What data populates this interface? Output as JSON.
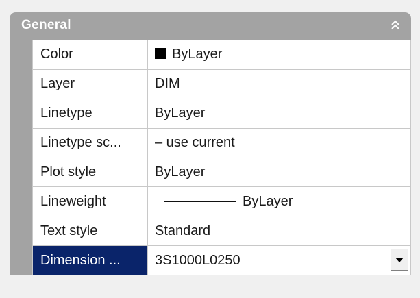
{
  "panel": {
    "section_title": "General",
    "collapse_icon": "chevron-double-up-icon"
  },
  "properties": [
    {
      "name": "Color",
      "value": "ByLayer",
      "swatch_color": "#000000"
    },
    {
      "name": "Layer",
      "value": "DIM"
    },
    {
      "name": "Linetype",
      "value": "ByLayer"
    },
    {
      "name": "Linetype sc...",
      "value": "– use current"
    },
    {
      "name": "Plot style",
      "value": "ByLayer"
    },
    {
      "name": "Lineweight",
      "value": "ByLayer"
    },
    {
      "name": "Text style",
      "value": "Standard"
    },
    {
      "name": "Dimension ...",
      "value": "3S1000L0250",
      "selected": true,
      "dropdown_icon": "dropdown-arrow-icon"
    }
  ],
  "colors": {
    "header_bg": "#a3a3a3",
    "selected_bg": "#0a246a",
    "grid_line": "#c8c8c8"
  }
}
